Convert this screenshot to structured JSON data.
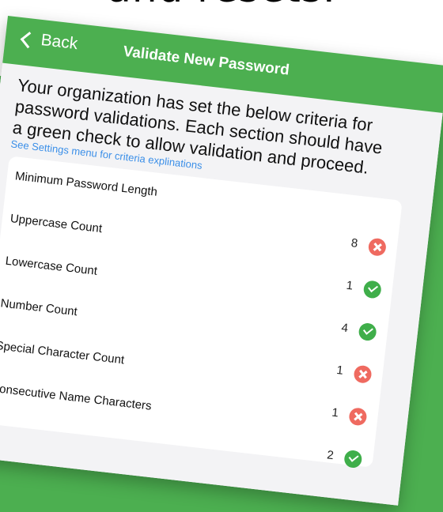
{
  "caption": {
    "partial_text": "and resets."
  },
  "navbar": {
    "back_label": "Back",
    "title": "Validate New Password"
  },
  "intro": {
    "text": "Your organization has set the below criteria for password validations. Each section should have a green check to allow validation and proceed.",
    "link": "See Settings menu for criteria explinations"
  },
  "criteria": [
    {
      "label": "Minimum Password Length",
      "count": "8",
      "status": "fail"
    },
    {
      "label": "Uppercase Count",
      "count": "1",
      "status": "pass"
    },
    {
      "label": "Lowercase Count",
      "count": "4",
      "status": "pass"
    },
    {
      "label": "Number Count",
      "count": "1",
      "status": "fail"
    },
    {
      "label": "Special Character Count",
      "count": "1",
      "status": "fail"
    },
    {
      "label": "Consecutive Name Characters",
      "count": "2",
      "status": "pass"
    }
  ],
  "colors": {
    "brand_green": "#4caf50",
    "pass": "#3fae4a",
    "fail": "#ef6a60",
    "link": "#3b8fe8"
  },
  "icons": {
    "back": "chevron-left-icon",
    "pass": "check-circle-icon",
    "fail": "x-circle-icon"
  }
}
